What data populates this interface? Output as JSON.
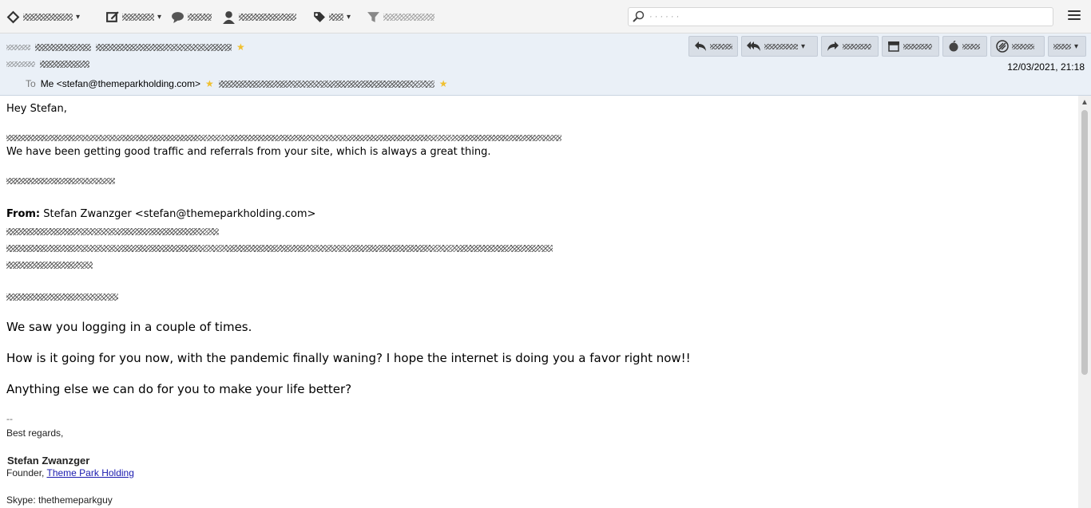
{
  "toolbar": {
    "items": [
      {
        "icon": "get-messages-icon",
        "width": 62
      },
      {
        "icon": "write-icon",
        "width": 40
      },
      {
        "icon": "chat-icon",
        "width": 30
      },
      {
        "icon": "address-book-icon",
        "width": 58
      },
      {
        "icon": "tag-icon",
        "width": 18
      },
      {
        "icon": "filter-icon",
        "width": 64
      }
    ],
    "search": {
      "icon": "search-icon",
      "placeholder": "· · · ·  · ·"
    },
    "menu_icon": "hamburger-menu-icon"
  },
  "header": {
    "to_label": "To",
    "to_value": "Me <stefan@themeparkholding.com>",
    "date": "12/03/2021, 21:18",
    "actions": [
      "reply-icon",
      "reply-all-icon",
      "forward-icon",
      "archive-icon",
      "junk-icon",
      "delete-icon",
      "more-icon"
    ]
  },
  "body": {
    "greeting": "Hey Stefan,",
    "line_traffic": "We have been getting good traffic and referrals from your site, which is always a great thing.",
    "from_label": "From:",
    "from_value": "Stefan Zwanzger <stefan@themeparkholding.com>",
    "para1": "We saw you logging in a couple of times.",
    "para2": "How is it going for you now, with the pandemic finally waning? I hope the internet is doing you a favor right now!!",
    "para3": "Anything else we can do for you to make your life better?",
    "sig_dash": "--",
    "regards": "Best regards,",
    "sig_name": "Stefan Zwanzger",
    "founder_prefix": "Founder,",
    "company_link": "Theme Park Holding",
    "skype": "Skype: thethemeparkguy"
  },
  "colors": {
    "header_bg": "#eaf0f7",
    "link": "#1a1aaf",
    "star": "#f0c030"
  }
}
